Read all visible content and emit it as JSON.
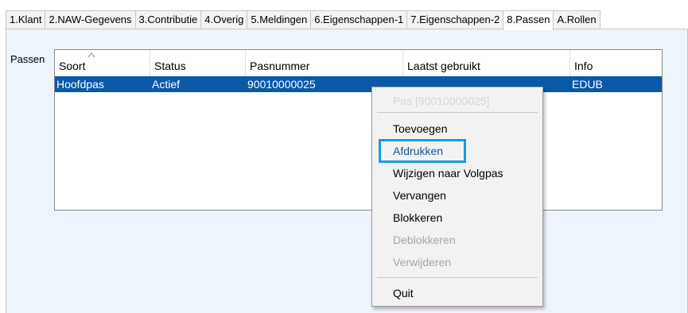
{
  "tabs": [
    {
      "label": "1.Klant"
    },
    {
      "label": "2.NAW-Gegevens"
    },
    {
      "label": "3.Contributie"
    },
    {
      "label": "4.Overig"
    },
    {
      "label": "5.Meldingen"
    },
    {
      "label": "6.Eigenschappen-1"
    },
    {
      "label": "7.Eigenschappen-2"
    },
    {
      "label": "8.Passen",
      "active": true
    },
    {
      "label": "A.Rollen"
    }
  ],
  "group": {
    "label": "Passen"
  },
  "grid": {
    "columns": [
      "Soort",
      "Status",
      "Pasnummer",
      "Laatst gebruikt",
      "Info"
    ],
    "sort_column": "Soort",
    "rows": [
      {
        "soort": "Hoofdpas",
        "status": "Actief",
        "pasnummer": "90010000025",
        "laatst_gebruikt": "",
        "info": "EDUB",
        "selected": true
      }
    ]
  },
  "context_menu": {
    "header": "Pas [90010000025]",
    "items": [
      {
        "label": "Toevoegen",
        "enabled": true
      },
      {
        "label": "Afdrukken",
        "enabled": true,
        "focused": true
      },
      {
        "label": "Wijzigen naar Volgpas",
        "enabled": true
      },
      {
        "label": "Vervangen",
        "enabled": true
      },
      {
        "label": "Blokkeren",
        "enabled": true
      },
      {
        "label": "Deblokkeren",
        "enabled": false
      },
      {
        "label": "Verwijderen",
        "enabled": false
      }
    ],
    "quit": "Quit"
  },
  "colors": {
    "selection": "#0a58a8",
    "focus_outline": "#1a9be0",
    "focused_text": "#1a4f9c",
    "panel_background": "#eef4fc"
  }
}
